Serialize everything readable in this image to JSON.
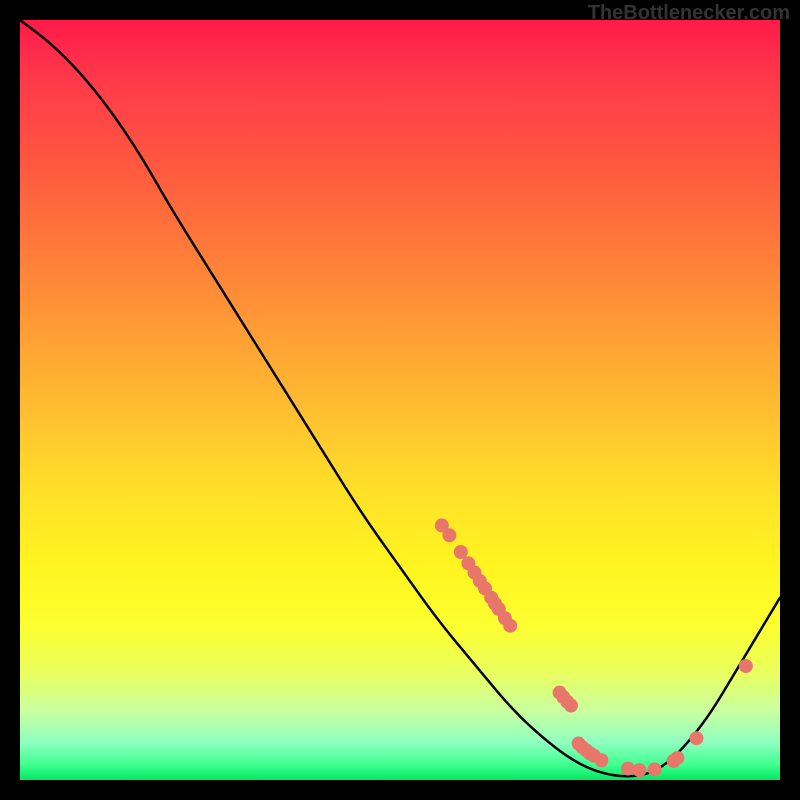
{
  "watermark": "TheBottlenecker.com",
  "chart_data": {
    "type": "line",
    "title": "",
    "xlabel": "",
    "ylabel": "",
    "xlim": [
      0,
      100
    ],
    "ylim": [
      0,
      100
    ],
    "curve": [
      {
        "x": 0,
        "y": 100
      },
      {
        "x": 4,
        "y": 97
      },
      {
        "x": 8,
        "y": 93
      },
      {
        "x": 12,
        "y": 88
      },
      {
        "x": 16,
        "y": 82
      },
      {
        "x": 20,
        "y": 75
      },
      {
        "x": 25,
        "y": 67
      },
      {
        "x": 30,
        "y": 59
      },
      {
        "x": 35,
        "y": 51
      },
      {
        "x": 40,
        "y": 43
      },
      {
        "x": 45,
        "y": 35
      },
      {
        "x": 50,
        "y": 28
      },
      {
        "x": 55,
        "y": 21
      },
      {
        "x": 60,
        "y": 15
      },
      {
        "x": 65,
        "y": 9
      },
      {
        "x": 70,
        "y": 4.5
      },
      {
        "x": 74,
        "y": 1.8
      },
      {
        "x": 78,
        "y": 0.5
      },
      {
        "x": 82,
        "y": 0.5
      },
      {
        "x": 85,
        "y": 2
      },
      {
        "x": 88,
        "y": 5
      },
      {
        "x": 91,
        "y": 9
      },
      {
        "x": 94,
        "y": 14
      },
      {
        "x": 97,
        "y": 19
      },
      {
        "x": 100,
        "y": 24
      }
    ],
    "points": [
      {
        "x": 55.5,
        "y": 33.5
      },
      {
        "x": 56.5,
        "y": 32.2
      },
      {
        "x": 58.0,
        "y": 30.0
      },
      {
        "x": 59.0,
        "y": 28.5
      },
      {
        "x": 59.8,
        "y": 27.3
      },
      {
        "x": 60.5,
        "y": 26.2
      },
      {
        "x": 61.2,
        "y": 25.2
      },
      {
        "x": 62.0,
        "y": 24.0
      },
      {
        "x": 62.5,
        "y": 23.2
      },
      {
        "x": 63.0,
        "y": 22.5
      },
      {
        "x": 63.8,
        "y": 21.3
      },
      {
        "x": 64.5,
        "y": 20.3
      },
      {
        "x": 71.0,
        "y": 11.5
      },
      {
        "x": 71.5,
        "y": 10.9
      },
      {
        "x": 72.0,
        "y": 10.3
      },
      {
        "x": 72.5,
        "y": 9.8
      },
      {
        "x": 73.5,
        "y": 4.8
      },
      {
        "x": 74.0,
        "y": 4.3
      },
      {
        "x": 74.5,
        "y": 3.9
      },
      {
        "x": 75.0,
        "y": 3.5
      },
      {
        "x": 75.5,
        "y": 3.2
      },
      {
        "x": 76.5,
        "y": 2.6
      },
      {
        "x": 80.0,
        "y": 1.5
      },
      {
        "x": 81.5,
        "y": 1.3
      },
      {
        "x": 83.5,
        "y": 1.4
      },
      {
        "x": 86.0,
        "y": 2.5
      },
      {
        "x": 86.5,
        "y": 2.9
      },
      {
        "x": 89.0,
        "y": 5.5
      },
      {
        "x": 95.5,
        "y": 15.0
      }
    ],
    "point_color": "#e8766a",
    "point_radius": 7
  }
}
